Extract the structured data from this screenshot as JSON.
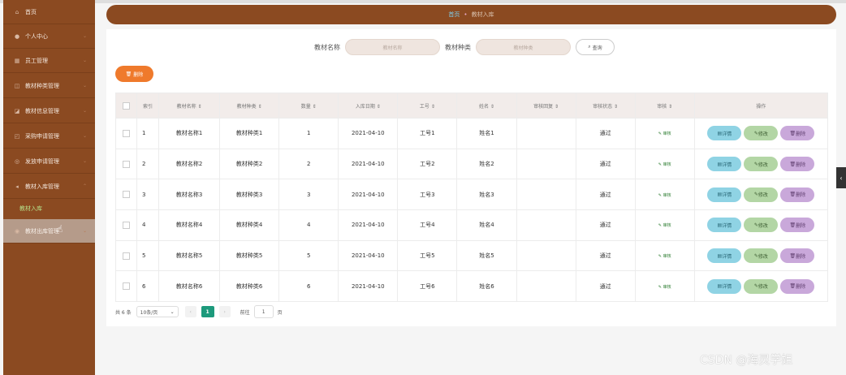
{
  "sidebar": {
    "items": [
      {
        "label": "首页",
        "icon": "home-icon",
        "glyph": "⌂"
      },
      {
        "label": "个人中心",
        "icon": "user-icon",
        "glyph": "●"
      },
      {
        "label": "员工管理",
        "icon": "group-icon",
        "glyph": "▦"
      },
      {
        "label": "教材种类管理",
        "icon": "category-icon",
        "glyph": "◫"
      },
      {
        "label": "教材信息管理",
        "icon": "book-icon",
        "glyph": "◪"
      },
      {
        "label": "采购申请管理",
        "icon": "cart-icon",
        "glyph": "◰"
      },
      {
        "label": "发放申请管理",
        "icon": "send-icon",
        "glyph": "◎"
      },
      {
        "label": "教材入库管理",
        "icon": "inbound-icon",
        "glyph": "◂"
      }
    ],
    "subitem": "教材入库",
    "active_item": {
      "label": "教材出库管理",
      "icon": "outbound-icon",
      "glyph": "◉"
    }
  },
  "breadcrumb": {
    "home": "首页",
    "separator": "•",
    "current": "教材入库"
  },
  "search": {
    "name_label": "教材名称",
    "name_placeholder": "教材名称",
    "type_label": "教材种类",
    "type_placeholder": "教材种类",
    "query_label": "查询",
    "query_icon": "search-icon"
  },
  "toolbar": {
    "delete_label": "删除",
    "delete_icon": "trash-icon"
  },
  "table": {
    "headers": [
      "索引",
      "教材名称 ⇕",
      "教材种类 ⇕",
      "数量 ⇕",
      "入库日期 ⇕",
      "工号 ⇕",
      "姓名 ⇕",
      "审核回复 ⇕",
      "审核状态 ⇕",
      "审核 ⇕",
      "操作"
    ],
    "audit_label": "审核",
    "action_labels": {
      "detail": "详情",
      "edit": "修改",
      "delete": "删除"
    },
    "rows": [
      {
        "index": "1",
        "name": "教材名称1",
        "type": "教材种类1",
        "qty": "1",
        "date": "2021-04-10",
        "job_no": "工号1",
        "person": "姓名1",
        "reply": "",
        "status": "通过"
      },
      {
        "index": "2",
        "name": "教材名称2",
        "type": "教材种类2",
        "qty": "2",
        "date": "2021-04-10",
        "job_no": "工号2",
        "person": "姓名2",
        "reply": "",
        "status": "通过"
      },
      {
        "index": "3",
        "name": "教材名称3",
        "type": "教材种类3",
        "qty": "3",
        "date": "2021-04-10",
        "job_no": "工号3",
        "person": "姓名3",
        "reply": "",
        "status": "通过"
      },
      {
        "index": "4",
        "name": "教材名称4",
        "type": "教材种类4",
        "qty": "4",
        "date": "2021-04-10",
        "job_no": "工号4",
        "person": "姓名4",
        "reply": "",
        "status": "通过"
      },
      {
        "index": "5",
        "name": "教材名称5",
        "type": "教材种类5",
        "qty": "5",
        "date": "2021-04-10",
        "job_no": "工号5",
        "person": "姓名5",
        "reply": "",
        "status": "通过"
      },
      {
        "index": "6",
        "name": "教材名称6",
        "type": "教材种类6",
        "qty": "6",
        "date": "2021-04-10",
        "job_no": "工号6",
        "person": "姓名6",
        "reply": "",
        "status": "通过"
      }
    ]
  },
  "pagination": {
    "total": "共 6 条",
    "page_size": "10条/页",
    "prev": "‹",
    "current_page": "1",
    "next": "›",
    "goto_prefix": "前往",
    "goto_value": "1",
    "goto_suffix": "页"
  },
  "watermark": "CSDN @海灵学姐",
  "colors": {
    "sidebar": "#8b4a21",
    "delete_button": "#ef7a2c",
    "pager_active": "#1d9a7c"
  }
}
